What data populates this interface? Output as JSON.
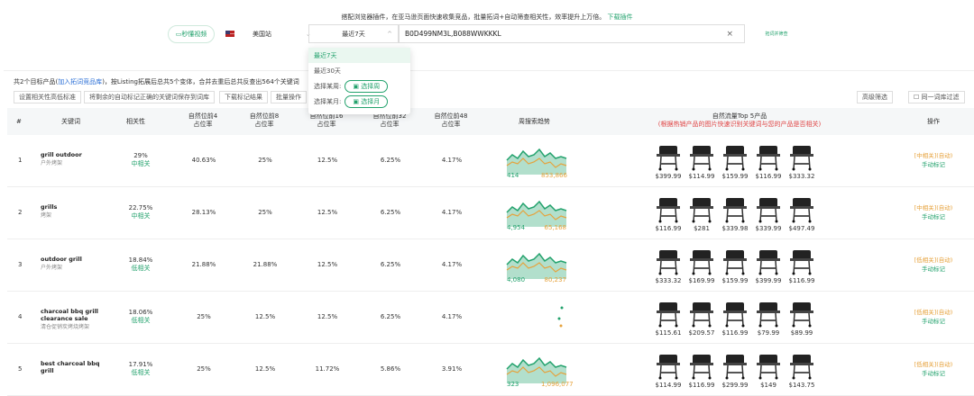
{
  "header": {
    "notice": "搭配浏览器插件，在亚马逊页面快速收集竞品，批量拓词+自动筛查相关性，效率提升上万倍。",
    "notice_link": "下载插件",
    "video_button": "秒懂视频",
    "site": "美国站",
    "date_range": "最近7天",
    "asin_value": "B0D499NM3L,B088WWKKKL",
    "expand_button": "拓词并筛查"
  },
  "dropdown": {
    "items": [
      "最近7天",
      "最近30天"
    ],
    "week_label": "选择某周:",
    "week_btn": "选择周",
    "month_label": "选择某月:",
    "month_btn": "选择月"
  },
  "summary": {
    "prefix": "共2个目标产品(",
    "link": "加入拓词竞品库",
    "suffix": ")，按Listing拓展后总共5个变体，合并去重后总共反查出564个关键词"
  },
  "toolbar": {
    "b1": "设置相关性高低标准",
    "b2": "将剩余的自动标记正确的关键词保存到词库",
    "b3": "下载标记结果",
    "b4": "批量操作",
    "adv": "高级筛选",
    "filter": "同一词库过滤"
  },
  "columns": {
    "num": "#",
    "kw": "关键词",
    "rel": "相关性",
    "p4a": "自然位前4",
    "p8a": "自然位前8",
    "p16a": "自然位前16",
    "p32a": "自然位前32",
    "p48a": "自然位前48",
    "rate": "占位率",
    "trend": "周搜索趋势",
    "top5": "自然流量Top 5产品",
    "top5sub": "(根据热销产品的图片快速识别关键词与您的产品是否相关)",
    "op": "操作"
  },
  "rows": [
    {
      "n": "1",
      "kw": "grill outdoor",
      "cn": "户外烤架",
      "rel": "29%",
      "lvl": "中相关",
      "p4": "40.63%",
      "p8": "25%",
      "p16": "12.5%",
      "p32": "6.25%",
      "p48": "4.17%",
      "t1": "414",
      "t2": "853,866",
      "prices": [
        "$399.99",
        "$114.99",
        "$159.99",
        "$116.99",
        "$333.32"
      ],
      "tag": "[中相关](自动)",
      "act": "手动标记"
    },
    {
      "n": "2",
      "kw": "grills",
      "cn": "烤架",
      "rel": "22.75%",
      "lvl": "中相关",
      "p4": "28.13%",
      "p8": "25%",
      "p16": "12.5%",
      "p32": "6.25%",
      "p48": "4.17%",
      "t1": "4,954",
      "t2": "65,168",
      "prices": [
        "$116.99",
        "$281",
        "$339.98",
        "$339.99",
        "$497.49"
      ],
      "tag": "[中相关](自动)",
      "act": "手动标记"
    },
    {
      "n": "3",
      "kw": "outdoor grill",
      "cn": "户外烤架",
      "rel": "18.84%",
      "lvl": "低相关",
      "p4": "21.88%",
      "p8": "21.88%",
      "p16": "12.5%",
      "p32": "6.25%",
      "p48": "4.17%",
      "t1": "4,080",
      "t2": "80,237",
      "prices": [
        "$333.32",
        "$169.99",
        "$159.99",
        "$399.99",
        "$116.99"
      ],
      "tag": "[低相关](自动)",
      "act": "手动标记"
    },
    {
      "n": "4",
      "kw": "charcoal bbq grill clearance sale",
      "cn": "清仓促销炭烤烧烤架",
      "rel": "18.06%",
      "lvl": "低相关",
      "p4": "25%",
      "p8": "12.5%",
      "p16": "12.5%",
      "p32": "6.25%",
      "p48": "4.17%",
      "t1": "",
      "t2": "",
      "prices": [
        "$115.61",
        "$209.57",
        "$116.99",
        "$79.99",
        "$89.99"
      ],
      "tag": "[低相关](自动)",
      "act": "手动标记"
    },
    {
      "n": "5",
      "kw": "best charcoal bbq grill",
      "cn": "",
      "rel": "17.91%",
      "lvl": "低相关",
      "p4": "25%",
      "p8": "12.5%",
      "p16": "11.72%",
      "p32": "5.86%",
      "p48": "3.91%",
      "t1": "323",
      "t2": "1,096,077",
      "prices": [
        "$114.99",
        "$116.99",
        "$299.99",
        "$149",
        "$143.75"
      ],
      "tag": "[低相关](自动)",
      "act": "手动标记"
    }
  ]
}
